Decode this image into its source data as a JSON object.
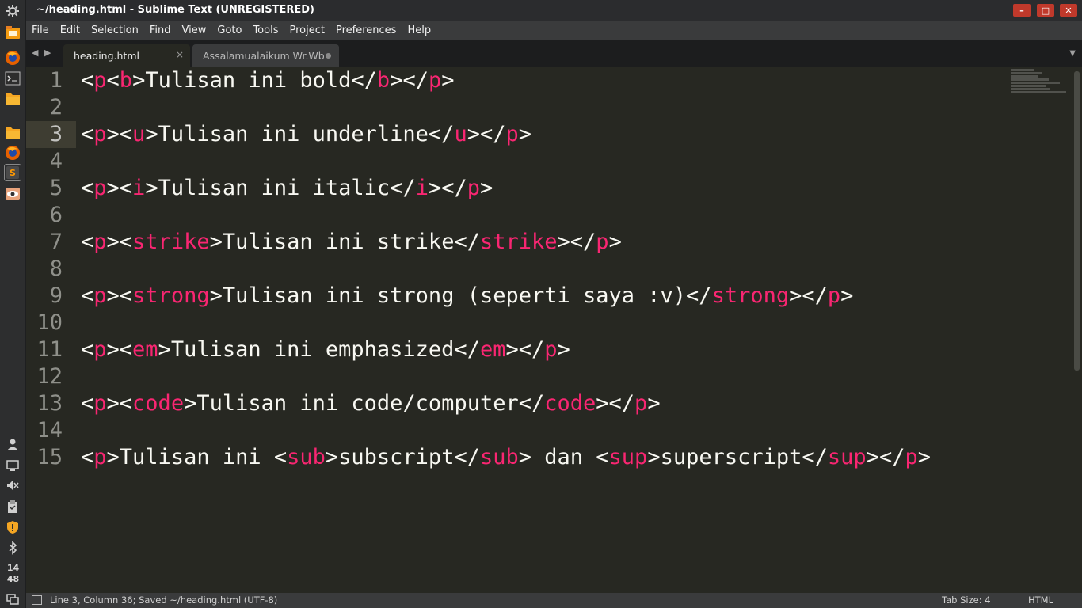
{
  "window": {
    "title": "~/heading.html - Sublime Text (UNREGISTERED)",
    "buttons": [
      "–",
      "□",
      "✕"
    ]
  },
  "dock": {
    "icons": [
      "settings-icon",
      "files-icon",
      "firefox-icon",
      "terminal-icon",
      "folder-icon",
      "folder-icon",
      "firefox-icon",
      "sublime-text-icon",
      "eye-icon",
      "user-icon",
      "display-icon",
      "volume-mute-icon",
      "clipboard-icon",
      "shield-icon",
      "bluetooth-icon",
      "workspace-icon"
    ],
    "clock_hour": "14",
    "clock_minute": "48"
  },
  "menu": [
    "File",
    "Edit",
    "Selection",
    "Find",
    "View",
    "Goto",
    "Tools",
    "Project",
    "Preferences",
    "Help"
  ],
  "tabs": {
    "active": {
      "label": "heading.html",
      "close": "×"
    },
    "inactive": {
      "label": "Assalamualaikum Wr.Wb"
    }
  },
  "editor": {
    "tag_color": "#f92672",
    "current_line": 3,
    "lines": [
      {
        "num": "1",
        "code": [
          [
            "<",
            "p"
          ],
          [
            "<",
            "b"
          ],
          [
            ">Tulisan ini bold</",
            "b"
          ],
          [
            "></",
            "p"
          ],
          [
            ">",
            ""
          ]
        ]
      },
      {
        "num": "2",
        "code": []
      },
      {
        "num": "3",
        "code": [
          [
            "<",
            "p"
          ],
          [
            "><",
            "u"
          ],
          [
            ">Tulisan ini underline</",
            "u"
          ],
          [
            "></",
            "p"
          ],
          [
            ">",
            ""
          ]
        ]
      },
      {
        "num": "4",
        "code": []
      },
      {
        "num": "5",
        "code": [
          [
            "<",
            "p"
          ],
          [
            "><",
            "i"
          ],
          [
            ">Tulisan ini italic</",
            "i"
          ],
          [
            "></",
            "p"
          ],
          [
            ">",
            ""
          ]
        ]
      },
      {
        "num": "6",
        "code": []
      },
      {
        "num": "7",
        "code": [
          [
            "<",
            "p"
          ],
          [
            "><",
            "strike"
          ],
          [
            ">Tulisan ini strike</",
            "strike"
          ],
          [
            "></",
            "p"
          ],
          [
            ">",
            ""
          ]
        ]
      },
      {
        "num": "8",
        "code": []
      },
      {
        "num": "9",
        "code": [
          [
            "<",
            "p"
          ],
          [
            "><",
            "strong"
          ],
          [
            ">Tulisan ini strong (seperti saya :v)</",
            "strong"
          ],
          [
            "></",
            "p"
          ],
          [
            ">",
            ""
          ]
        ]
      },
      {
        "num": "10",
        "code": []
      },
      {
        "num": "11",
        "code": [
          [
            "<",
            "p"
          ],
          [
            "><",
            "em"
          ],
          [
            ">Tulisan ini emphasized</",
            "em"
          ],
          [
            "></",
            "p"
          ],
          [
            ">",
            ""
          ]
        ]
      },
      {
        "num": "12",
        "code": []
      },
      {
        "num": "13",
        "code": [
          [
            "<",
            "p"
          ],
          [
            "><",
            "code"
          ],
          [
            ">Tulisan ini code/computer</",
            "code"
          ],
          [
            "></",
            "p"
          ],
          [
            ">",
            ""
          ]
        ]
      },
      {
        "num": "14",
        "code": []
      },
      {
        "num": "15",
        "code": [
          [
            "<",
            "p"
          ],
          [
            ">Tulisan ini <",
            "sub"
          ],
          [
            ">subscript</",
            "sub"
          ],
          [
            "> dan <",
            "sup"
          ],
          [
            ">superscript</",
            "sup"
          ],
          [
            "></",
            "p"
          ],
          [
            ">",
            ""
          ]
        ]
      }
    ]
  },
  "status": {
    "left": "Line 3, Column 36; Saved ~/heading.html (UTF-8)",
    "tab_size": "Tab Size: 4",
    "syntax": "HTML"
  }
}
